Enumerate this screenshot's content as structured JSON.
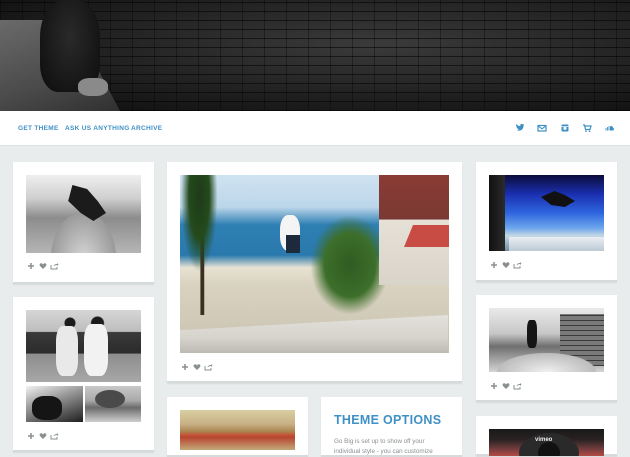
{
  "nav": {
    "links": [
      "GET THEME",
      "ASK US ANYTHING",
      "ARCHIVE"
    ],
    "icons": [
      "twitter-icon",
      "mail-icon",
      "instagram-icon",
      "cart-icon",
      "soundcloud-icon"
    ]
  },
  "colors": {
    "accent": "#3f90c6",
    "page_bg": "#e9ecec",
    "card_bg": "#ffffff",
    "icon_gray": "#8a8f91"
  },
  "cards": [
    {
      "id": "skate-bowl",
      "kind": "photo-post",
      "actions": [
        "add-icon",
        "heart-icon",
        "share-icon"
      ]
    },
    {
      "id": "two-skaters",
      "kind": "photoset-post",
      "actions": [
        "add-icon",
        "heart-icon",
        "share-icon"
      ]
    },
    {
      "id": "beach-skate",
      "kind": "photo-post",
      "actions": [
        "add-icon",
        "heart-icon",
        "share-icon"
      ]
    },
    {
      "id": "sky-skate",
      "kind": "photo-post",
      "actions": [
        "add-icon",
        "heart-icon",
        "share-icon"
      ]
    },
    {
      "id": "pool-skate",
      "kind": "photo-post",
      "actions": [
        "add-icon",
        "heart-icon",
        "share-icon"
      ]
    },
    {
      "id": "warm-photo",
      "kind": "photo-post"
    },
    {
      "id": "vimeo-video",
      "kind": "video-post",
      "label": "vimeo"
    }
  ],
  "theme_options": {
    "title": "THEME OPTIONS",
    "body_line1": "Go Big is set up to show off your",
    "body_line2": "individual style - you can customize"
  }
}
